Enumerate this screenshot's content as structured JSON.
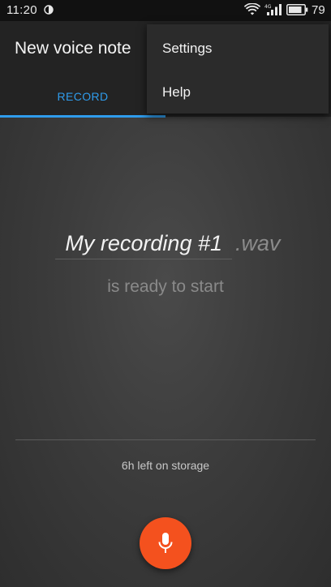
{
  "status_bar": {
    "time": "11:20",
    "battery_percent": "79",
    "icons": [
      "half-moon-icon",
      "wifi-icon",
      "signal-4g-icon",
      "battery-icon"
    ]
  },
  "app_bar": {
    "title": "New voice note",
    "tabs": [
      {
        "label": "RECORD",
        "selected": true
      }
    ]
  },
  "overflow_menu": {
    "items": [
      {
        "label": "Settings"
      },
      {
        "label": "Help"
      }
    ]
  },
  "recorder": {
    "filename": "My recording #1",
    "extension": ".wav",
    "status": "is ready to start",
    "storage_left": "6h left on storage",
    "record_icon": "microphone-icon"
  },
  "colors": {
    "accent": "#2f9cec",
    "fab": "#f4511e",
    "app_bar": "#232323"
  }
}
